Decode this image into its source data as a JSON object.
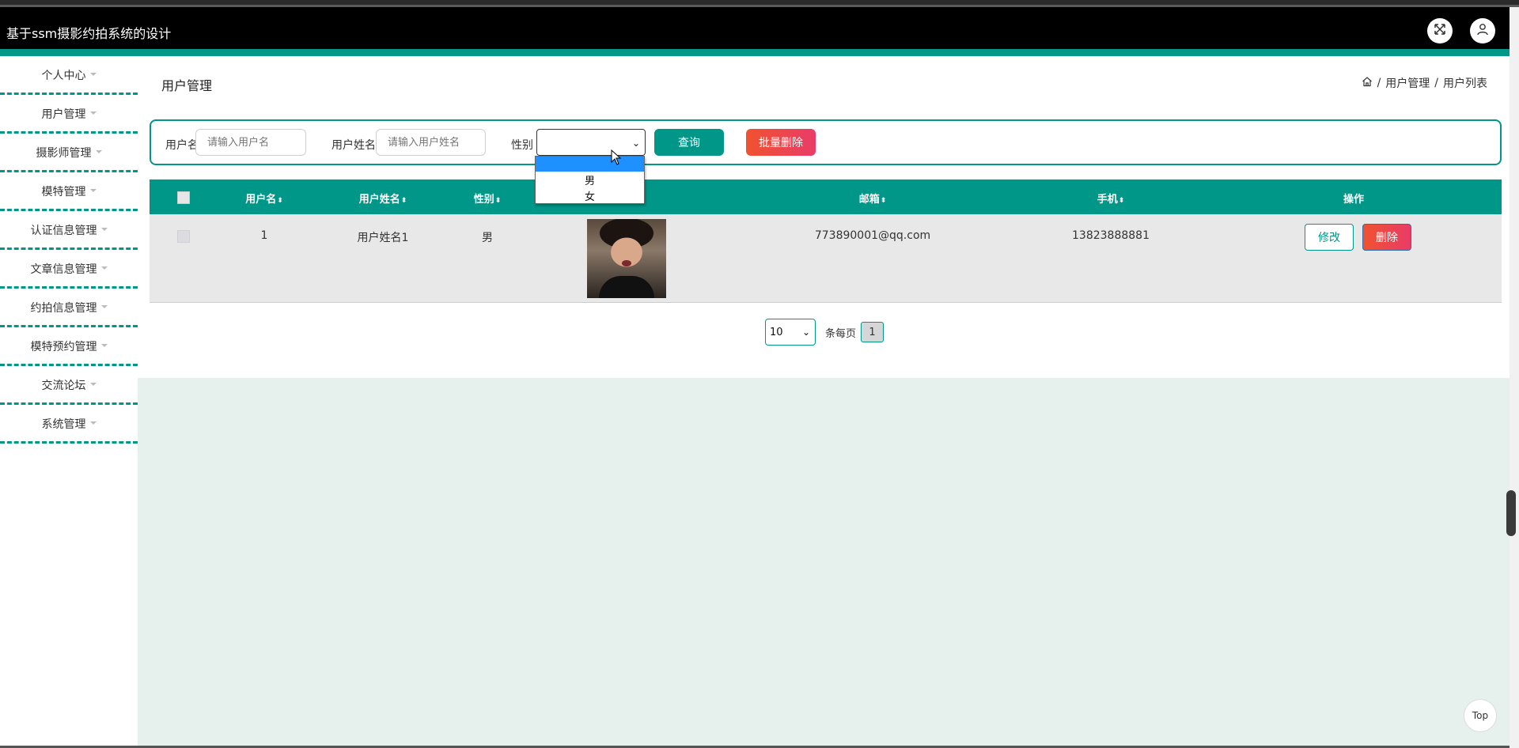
{
  "header": {
    "title": "基于ssm摄影约拍系统的设计",
    "fullscreen_icon": "fullscreen-icon",
    "user_icon": "user-icon"
  },
  "theme": {
    "accent": "#009688",
    "danger": "#f0522f",
    "header_bg": "#000000"
  },
  "sidebar": {
    "items": [
      {
        "label": "个人中心"
      },
      {
        "label": "用户管理"
      },
      {
        "label": "摄影师管理"
      },
      {
        "label": "模特管理"
      },
      {
        "label": "认证信息管理"
      },
      {
        "label": "文章信息管理"
      },
      {
        "label": "约拍信息管理"
      },
      {
        "label": "模特预约管理"
      },
      {
        "label": "交流论坛"
      },
      {
        "label": "系统管理"
      }
    ]
  },
  "page": {
    "title": "用户管理",
    "breadcrumb": {
      "home_icon": "home-icon",
      "sep": "/",
      "level1": "用户管理",
      "level2": "用户列表"
    }
  },
  "search": {
    "username_label": "用户名",
    "username_placeholder": "请输入用户名",
    "realname_label": "用户姓名",
    "realname_placeholder": "请输入用户姓名",
    "gender_label": "性别",
    "gender_value": "",
    "gender_options": [
      "",
      "男",
      "女"
    ],
    "query_button": "查询",
    "batch_delete_button": "批量删除"
  },
  "table": {
    "headers": {
      "username": "用户名",
      "realname": "用户姓名",
      "gender": "性别",
      "email": "邮箱",
      "phone": "手机",
      "actions": "操作"
    },
    "sort_glyph": "⬍",
    "rows": [
      {
        "username": "1",
        "realname": "用户姓名1",
        "gender": "男",
        "email": "773890001@qq.com",
        "phone": "13823888881",
        "edit_label": "修改",
        "delete_label": "删除"
      }
    ]
  },
  "pagination": {
    "page_size": "10",
    "per_page_label": "条每页",
    "current_page": "1"
  },
  "top_button": "Top"
}
